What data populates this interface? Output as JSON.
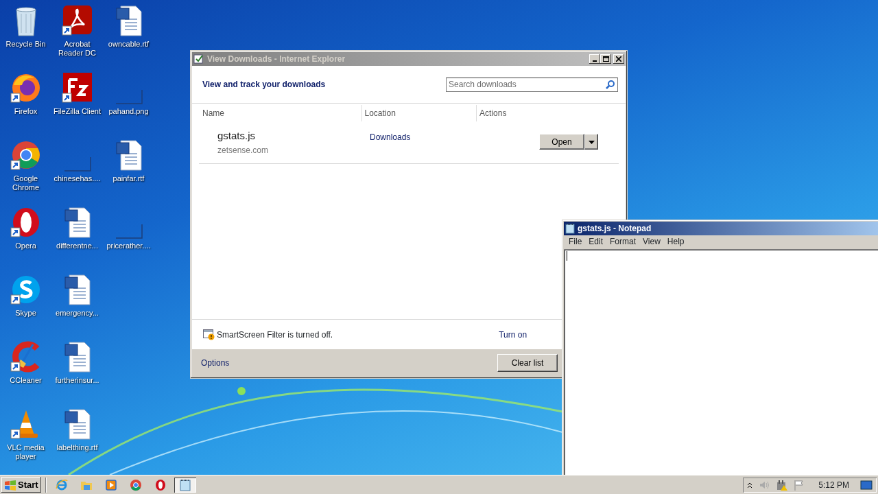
{
  "desktop_icons": [
    [
      {
        "label": "Recycle Bin",
        "kind": "recycle",
        "shortcut": false
      },
      {
        "label": "Firefox",
        "kind": "firefox",
        "shortcut": true
      },
      {
        "label": "Google Chrome",
        "kind": "chrome",
        "shortcut": true
      },
      {
        "label": "Opera",
        "kind": "opera",
        "shortcut": true
      },
      {
        "label": "Skype",
        "kind": "skype",
        "shortcut": true
      },
      {
        "label": "CCleaner",
        "kind": "ccleaner",
        "shortcut": true
      },
      {
        "label": "VLC media player",
        "kind": "vlc",
        "shortcut": true
      }
    ],
    [
      {
        "label": "Acrobat Reader DC",
        "kind": "acrobat",
        "shortcut": true
      },
      {
        "label": "FileZilla Client",
        "kind": "filezilla",
        "shortcut": true
      },
      {
        "label": "chinesehas....",
        "kind": "blank",
        "shortcut": false
      },
      {
        "label": "differentne...",
        "kind": "word",
        "shortcut": false
      },
      {
        "label": "emergency...",
        "kind": "word",
        "shortcut": false
      },
      {
        "label": "furtherinsur...",
        "kind": "word",
        "shortcut": false
      },
      {
        "label": "labelthing.rtf",
        "kind": "word",
        "shortcut": false
      }
    ],
    [
      {
        "label": "owncable.rtf",
        "kind": "word",
        "shortcut": false
      },
      {
        "label": "pahand.png",
        "kind": "blank",
        "shortcut": false
      },
      {
        "label": "painfar.rtf",
        "kind": "word",
        "shortcut": false
      },
      {
        "label": "pricerather....",
        "kind": "blank",
        "shortcut": false
      }
    ]
  ],
  "downloads_window": {
    "title": "View Downloads - Internet Explorer",
    "active": false,
    "heading": "View and track your downloads",
    "search": {
      "placeholder": "Search downloads"
    },
    "columns": [
      "Name",
      "Location",
      "Actions"
    ],
    "downloads": [
      {
        "name": "gstats.js",
        "source": "zetsense.com",
        "location": "Downloads",
        "action": "Open"
      }
    ],
    "smartscreen": {
      "message": "SmartScreen Filter is turned off.",
      "link": "Turn on"
    },
    "options": "Options",
    "buttons": [
      "Clear list"
    ]
  },
  "notepad": {
    "title": "gstats.js - Notepad",
    "active": true,
    "menu": [
      "File",
      "Edit",
      "Format",
      "View",
      "Help"
    ]
  },
  "taskbar": {
    "start": "Start",
    "apps": [
      {
        "kind": "ie",
        "selected": false
      },
      {
        "kind": "folder",
        "selected": false
      },
      {
        "kind": "media",
        "selected": false
      },
      {
        "kind": "chrome",
        "selected": false
      },
      {
        "kind": "opera",
        "selected": false
      },
      {
        "kind": "notepad",
        "selected": true
      }
    ],
    "clock": "5:12 PM"
  }
}
